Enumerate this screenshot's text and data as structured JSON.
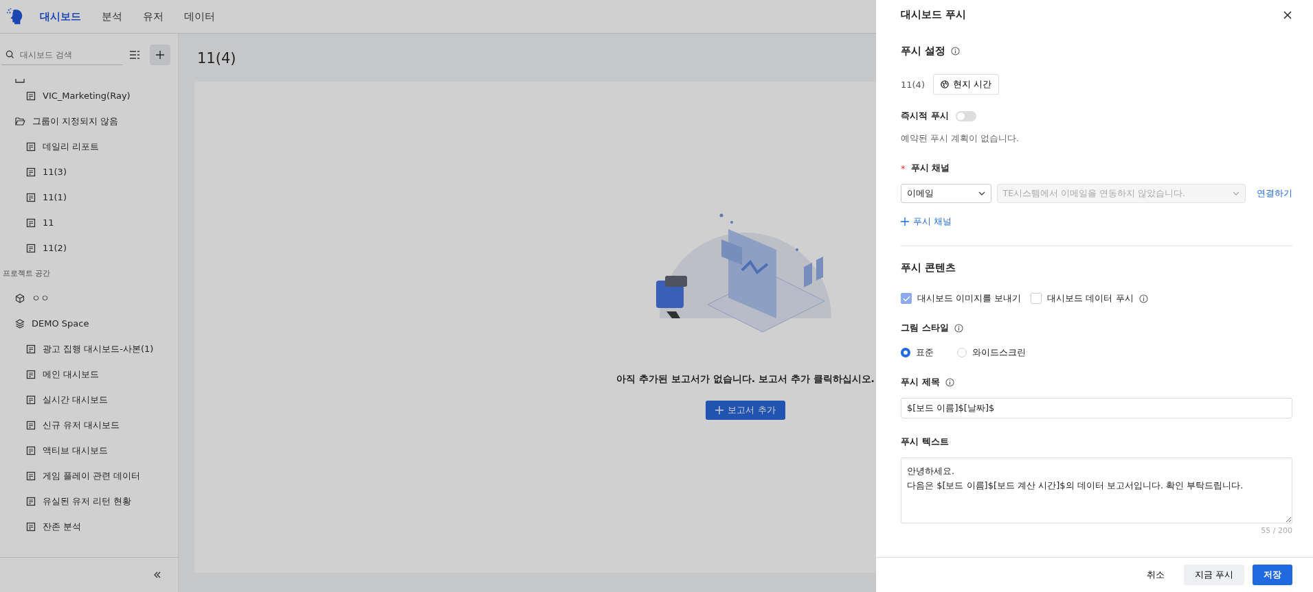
{
  "nav": {
    "tabs": [
      {
        "label": "대시보드",
        "selected": true
      },
      {
        "label": "분석",
        "selected": false
      },
      {
        "label": "유저",
        "selected": false
      },
      {
        "label": "데이터",
        "selected": false
      }
    ]
  },
  "sidebar": {
    "search": {
      "placeholder": "대시보드 검색"
    },
    "tree": [
      {
        "kind": "doc",
        "label": "VIC_Marketing(Ray)"
      },
      {
        "kind": "folder",
        "label": "그룹이 지정되지 않음",
        "children": [
          {
            "kind": "doc",
            "label": "데일리 리포트"
          },
          {
            "kind": "doc",
            "label": "11(3)"
          },
          {
            "kind": "doc",
            "label": "11(1)"
          },
          {
            "kind": "doc",
            "label": "11"
          },
          {
            "kind": "doc",
            "label": "11(2)"
          }
        ]
      },
      {
        "kind": "section",
        "label": "프로젝트 공간"
      },
      {
        "kind": "space",
        "label": "ㅇㅇ"
      },
      {
        "kind": "stack",
        "label": "DEMO Space",
        "children": [
          {
            "kind": "doc",
            "label": "광고 집행 대시보드-사본(1)"
          },
          {
            "kind": "doc",
            "label": "메인 대시보드"
          },
          {
            "kind": "doc",
            "label": "실시간 대시보드"
          },
          {
            "kind": "doc",
            "label": "신규 유저 대시보드"
          },
          {
            "kind": "doc",
            "label": "액티브 대시보드"
          },
          {
            "kind": "doc",
            "label": "게임 플레이 관련 데이터"
          },
          {
            "kind": "doc",
            "label": "유실된 유저 리턴 현황"
          },
          {
            "kind": "doc",
            "label": "잔존 분석"
          }
        ]
      }
    ]
  },
  "main": {
    "title": "11(4)",
    "empty_message": "아직 추가된 보고서가 없습니다. 보고서 추가 클릭하십시오.",
    "add_button": "보고서 추가"
  },
  "drawer": {
    "title": "대시보드 푸시",
    "push_settings": {
      "heading": "푸시 설정",
      "dashboard": "11(4)",
      "timezone_button": "현지 시간",
      "instant_label": "즉시적 푸시",
      "instant_on": false,
      "note": "예약된 푸시 계획이 없습니다."
    },
    "channels": {
      "heading": "푸시 채널",
      "required_mark": "*",
      "channel": "이메일",
      "target_placeholder": "TE시스템에서 이메일을 연동하지 않았습니다.",
      "connect_link": "연결하기",
      "add_link": "푸시 채널"
    },
    "content": {
      "heading": "푸시 콘텐츠",
      "options": [
        {
          "label": "대시보드 이미지를 보내기",
          "checked": true,
          "info": false
        },
        {
          "label": "대시보드 데이터 푸시",
          "checked": false,
          "info": true
        }
      ],
      "style_heading": "그림 스타일",
      "styles": [
        {
          "label": "표준",
          "selected": true
        },
        {
          "label": "와이드스크린",
          "selected": false
        }
      ],
      "title_heading": "푸시 제목",
      "title_value": "$[보드 이름]$[날짜]$",
      "text_heading": "푸시 텍스트",
      "text_value": "안녕하세요.\n다음은 $[보드 이름]$[보드 계산 시간]$의 데이터 보고서입니다. 확인 부탁드립니다.",
      "counter": "55 / 200"
    },
    "footer": {
      "cancel": "취소",
      "push_now": "지금 푸시",
      "save": "저장"
    }
  }
}
